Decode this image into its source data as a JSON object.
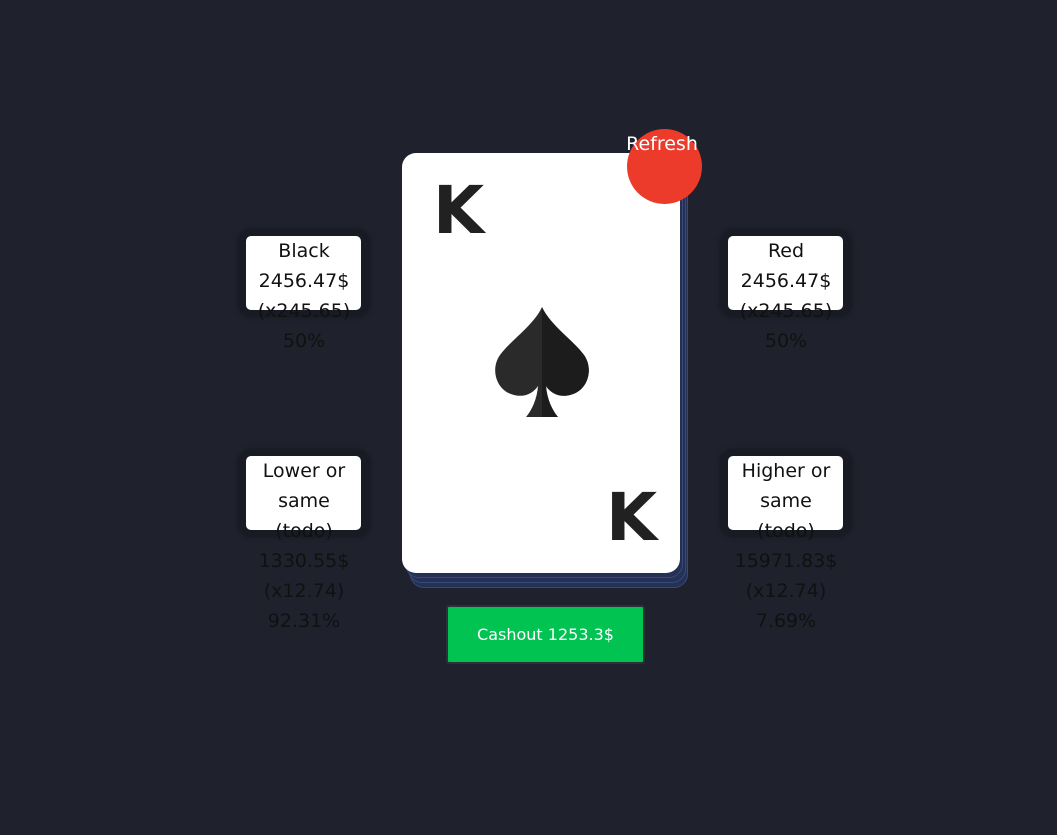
{
  "card": {
    "rank": "K",
    "suit_icon": "spade-icon",
    "suit_color": "#212121"
  },
  "refresh": {
    "label": "Refresh",
    "color": "#ec3b2b"
  },
  "options": {
    "black": {
      "title": "Black",
      "payout": "2456.47$",
      "multiplier": "(x245.65)",
      "probability": "50%"
    },
    "red": {
      "title": "Red",
      "payout": "2456.47$",
      "multiplier": "(x245.65)",
      "probability": "50%"
    },
    "lower": {
      "title_line1": "Lower or",
      "title_line2": "same",
      "note": "(todo)",
      "payout": "1330.55$",
      "multiplier": "(x12.74)",
      "probability": "92.31%"
    },
    "higher": {
      "title_line1": "Higher or",
      "title_line2": "same",
      "note": "(todo)",
      "payout": "15971.83$",
      "multiplier": "(x12.74)",
      "probability": "7.69%"
    }
  },
  "cashout": {
    "label": "Cashout 1253.3$",
    "color": "#00c352"
  },
  "theme": {
    "background": "#1f212d",
    "deck_back": "#243155"
  }
}
